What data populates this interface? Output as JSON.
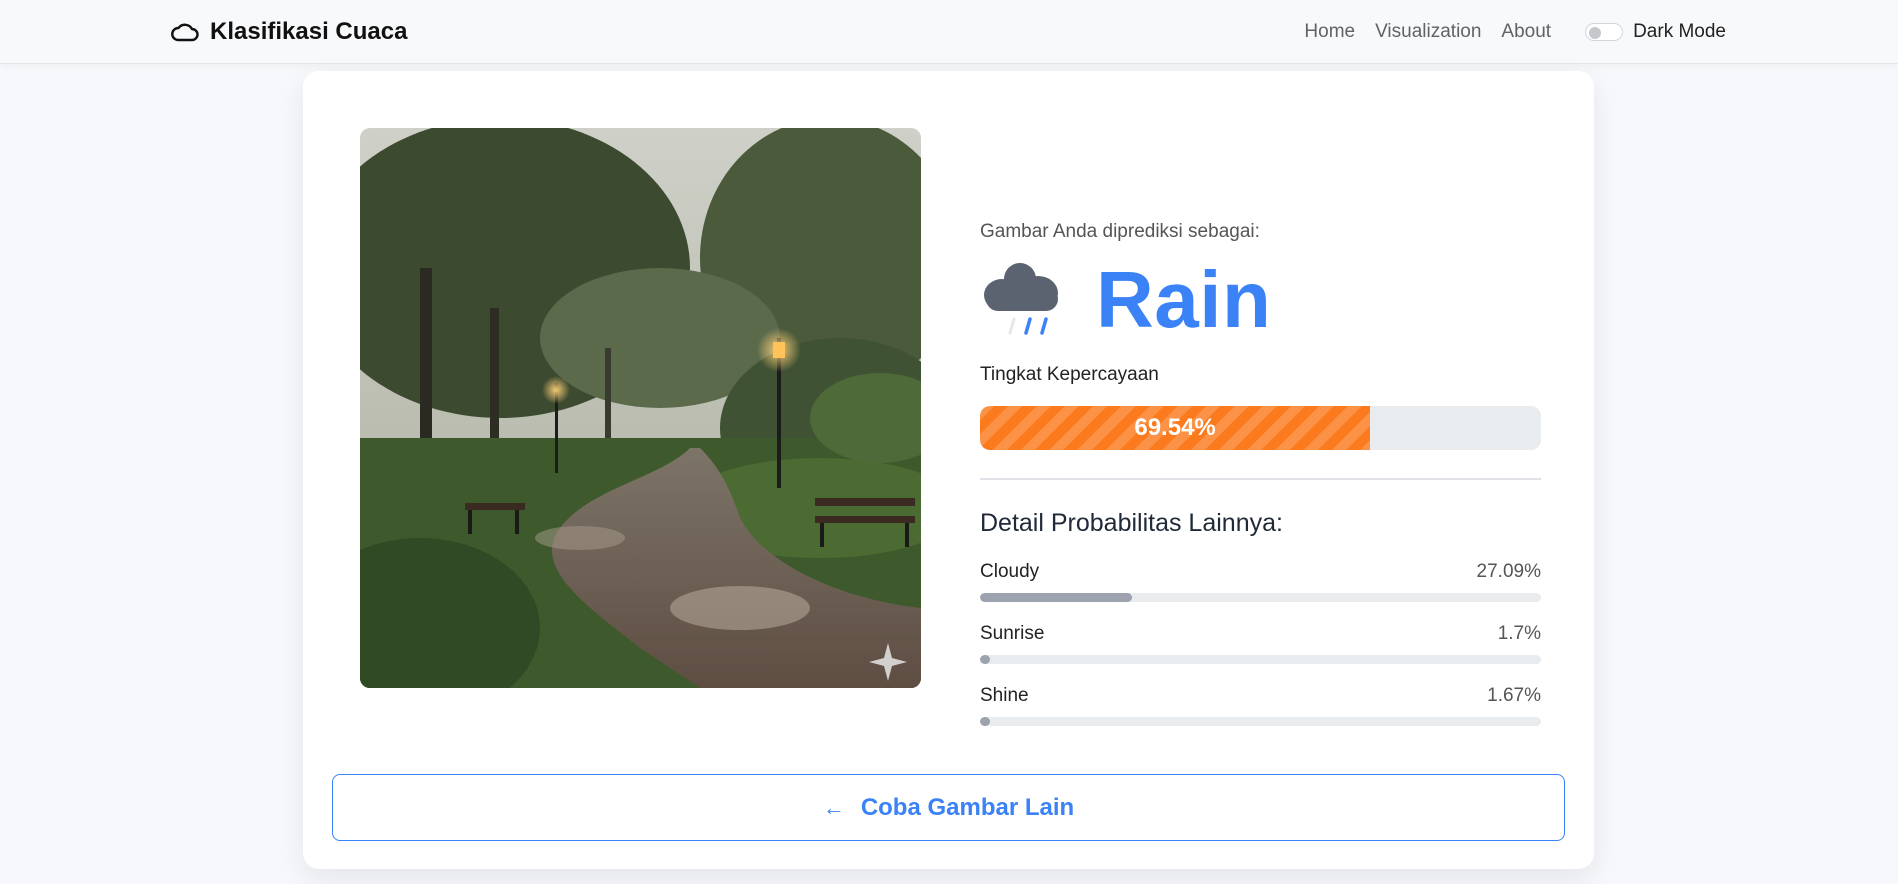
{
  "nav": {
    "brand": "Klasifikasi Cuaca",
    "brand_icon": "cloud-icon",
    "links": [
      "Home",
      "Visualization",
      "About"
    ],
    "dark_mode_label": "Dark Mode",
    "dark_mode_on": false
  },
  "result": {
    "predicted_label": "Gambar Anda diprediksi sebagai:",
    "predicted_class": "Rain",
    "predicted_icon": "rain-cloud-icon",
    "confidence_label": "Tingkat Kepercayaan",
    "confidence_text": "69.54%",
    "confidence_value": 69.54,
    "confidence_color": "#fb7a1e",
    "detail_title": "Detail Probabilitas Lainnya:",
    "others": [
      {
        "name": "Cloudy",
        "value_text": "27.09%",
        "value": 27.09
      },
      {
        "name": "Sunrise",
        "value_text": "1.7%",
        "value": 1.7
      },
      {
        "name": "Shine",
        "value_text": "1.67%",
        "value": 1.67
      }
    ]
  },
  "image": {
    "subject": "rainy park path with benches and lamp posts",
    "icon": "sparkle-icon"
  },
  "retry": {
    "arrow": "←",
    "label": "Coba Gambar Lain"
  },
  "colors": {
    "accent": "#3b82f6",
    "bar_fill": "#9ca3af"
  }
}
